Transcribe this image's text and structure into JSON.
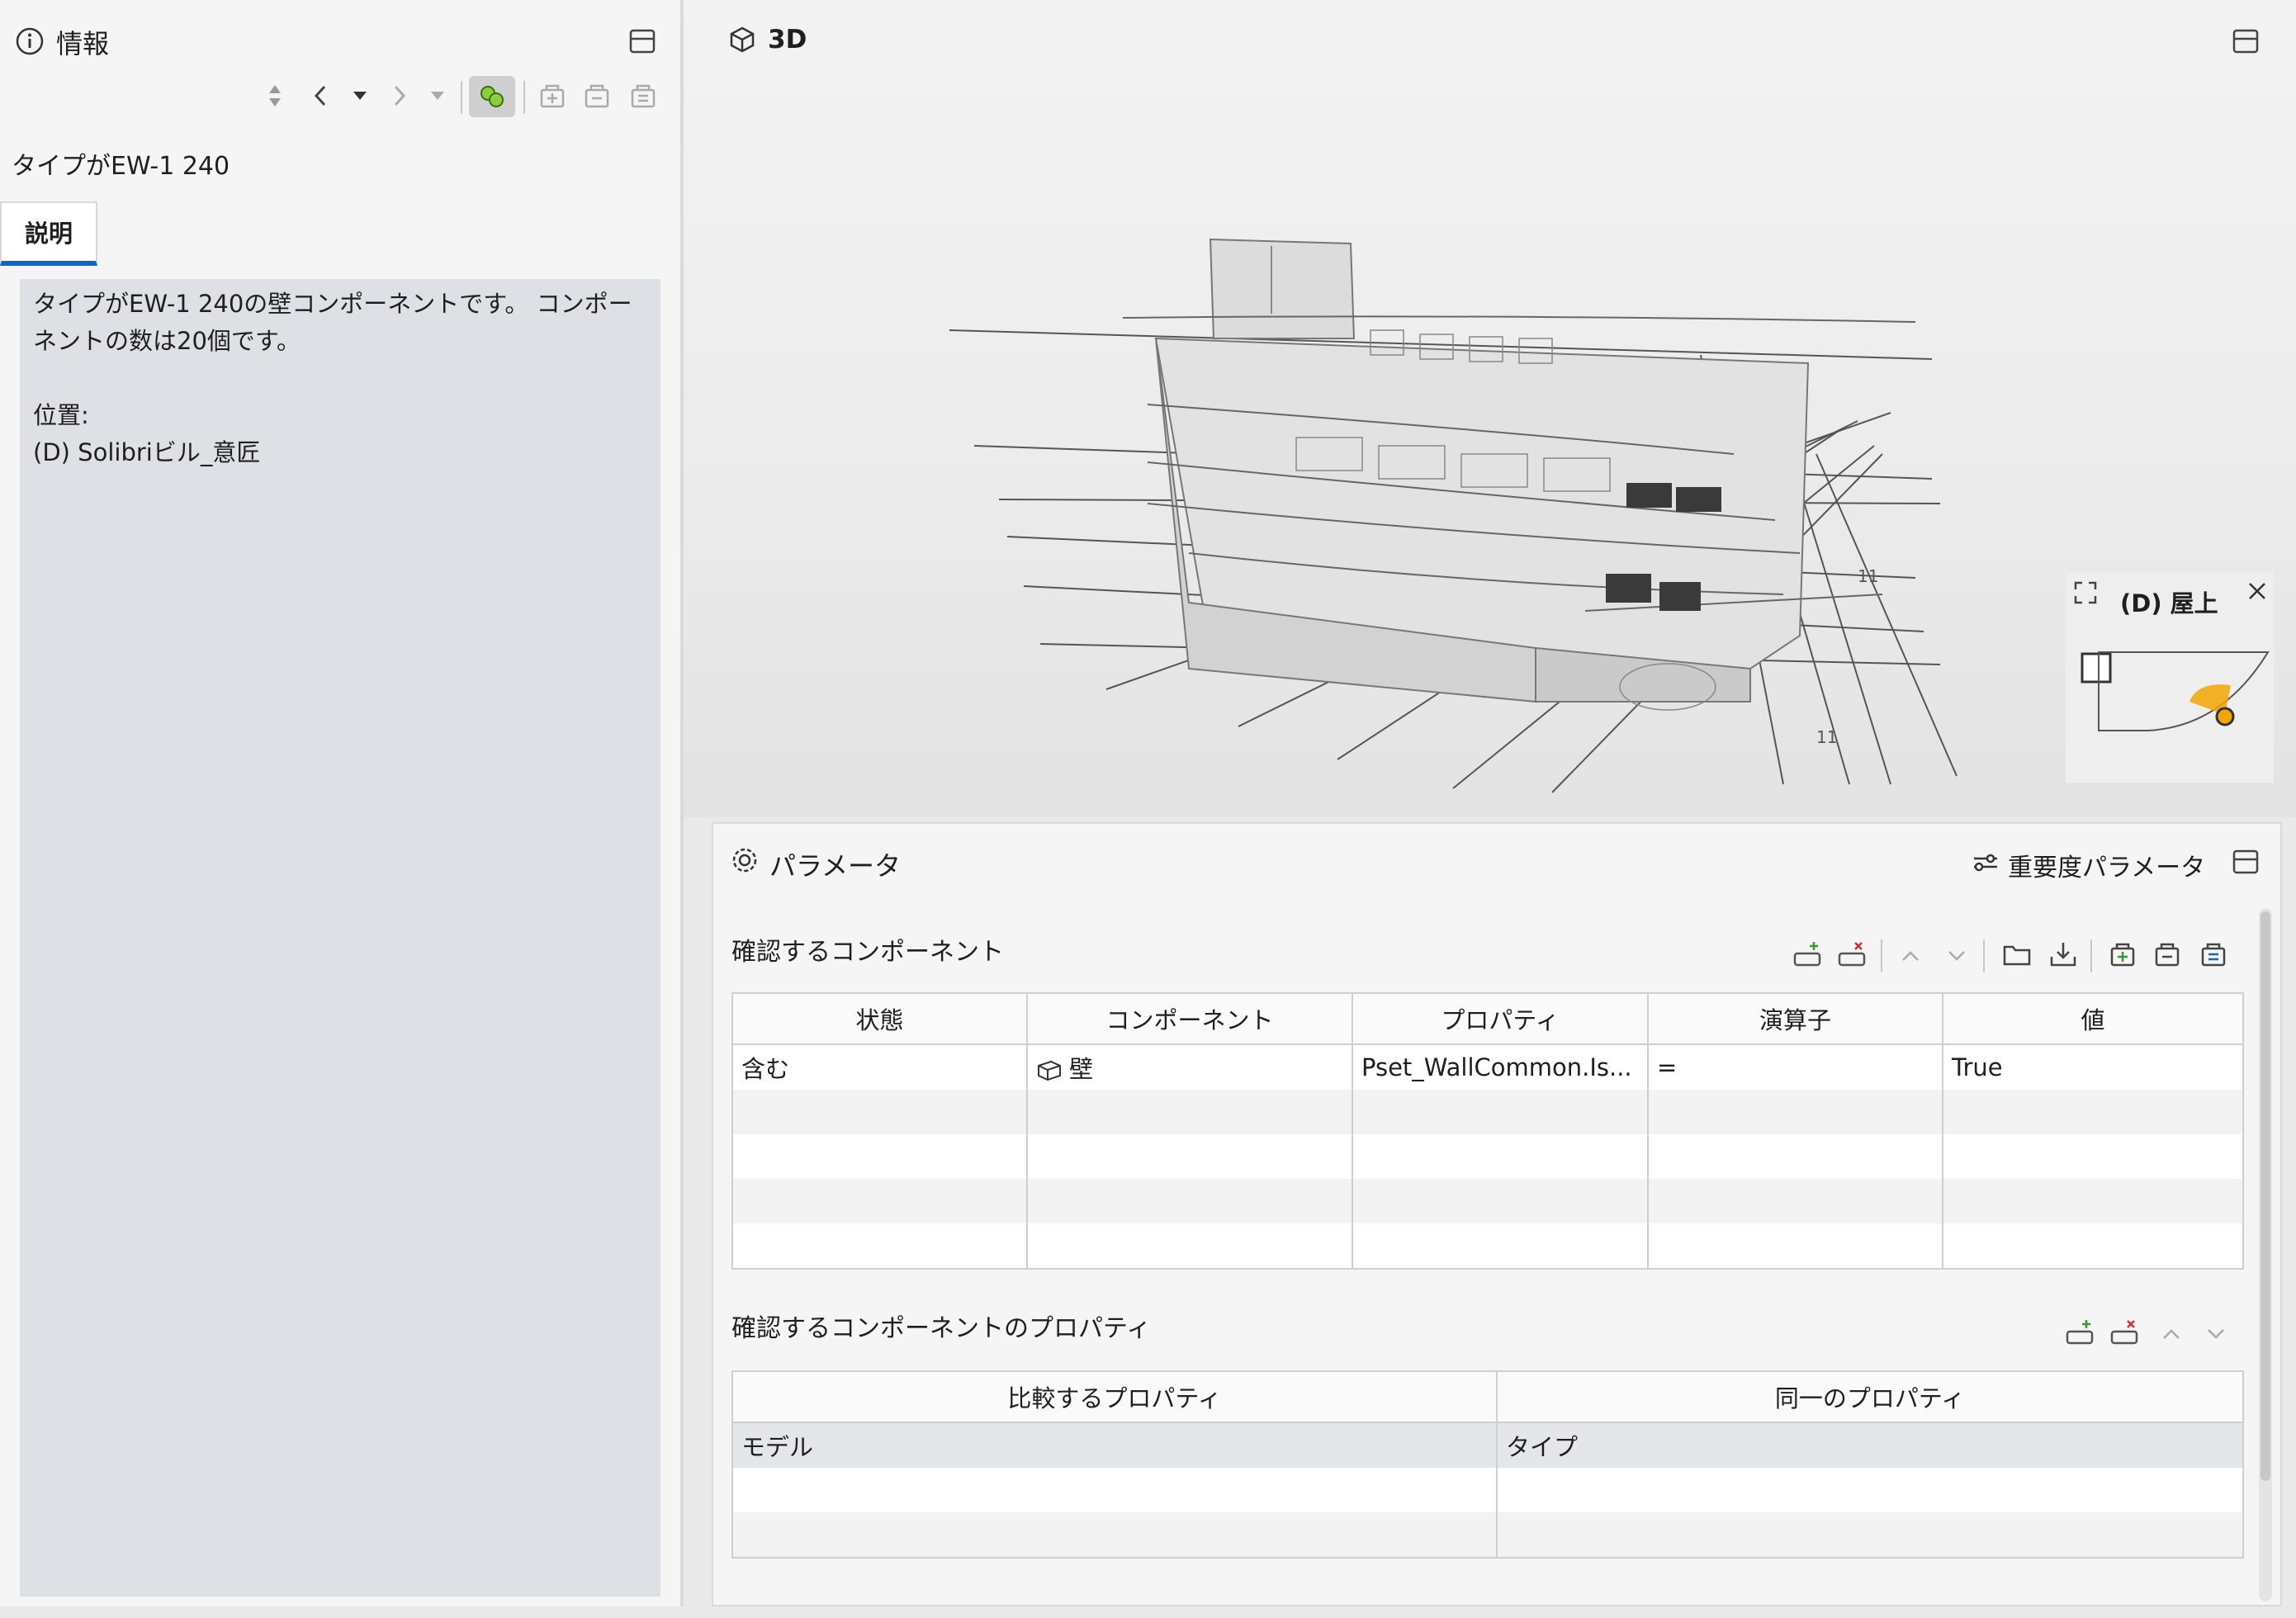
{
  "info_panel": {
    "title": "情報",
    "subtitle": "タイプがEW-1 240",
    "tab_label": "説明",
    "description": "タイプがEW-1 240の壁コンポーネントです。 コンポー\nネントの数は20個です。\n\n位置:\n(D) Solibriビル_意匠"
  },
  "viewport": {
    "title": "3D",
    "minimap": {
      "label": "(D) 屋上"
    },
    "grid_labels": [
      "11",
      "11"
    ]
  },
  "parameters": {
    "title": "パラメータ",
    "importance_label": "重要度パラメータ",
    "components_section": {
      "title": "確認するコンポーネント",
      "headers": [
        "状態",
        "コンポーネント",
        "プロパティ",
        "演算子",
        "値"
      ],
      "rows": [
        {
          "state": "含む",
          "component": "壁",
          "property": "Pset_WallCommon.Is...",
          "operator": "=",
          "value": "True"
        }
      ]
    },
    "properties_section": {
      "title": "確認するコンポーネントのプロパティ",
      "headers": [
        "比較するプロパティ",
        "同一のプロパティ"
      ],
      "rows": [
        {
          "compare": "モデル",
          "same": "タイプ"
        }
      ]
    }
  },
  "colors": {
    "accent_blue": "#1565c0",
    "selected_toggle": "#8ccf3c",
    "minimap_marker": "#f2a600"
  }
}
